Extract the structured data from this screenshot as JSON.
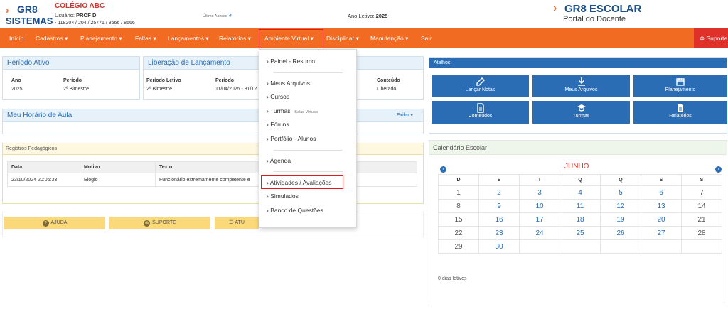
{
  "header": {
    "logo_left_line1": "GR8",
    "logo_left_line2": "SISTEMAS",
    "school": "COLÉGIO ABC",
    "user_label": "Usuário:",
    "user_name": "PROF D",
    "codes": "- 118204 / 204 / 25771 / 8666 / 8666",
    "ultimo_acesso": "Último Acesso",
    "ano_label": "Ano Letivo:",
    "ano_value": "2025",
    "logo_right_line1": "GR8 ESCOLAR",
    "logo_right_line2": "Portal do Docente"
  },
  "nav": {
    "items": [
      "Início",
      "Cadastros ▾",
      "Planejamento ▾",
      "Faltas ▾",
      "Lançamentos ▾",
      "Relatórios ▾",
      "Ambiente Virtual ▾",
      "Disciplinar ▾",
      "Manutenção ▾",
      "Sair"
    ],
    "suporte": "Suporte"
  },
  "periodo": {
    "title": "Período Ativo",
    "ano_label": "Ano",
    "ano_value": "2025",
    "periodo_label": "Período",
    "periodo_value": "2º Bimestre"
  },
  "liberacao": {
    "title": "Liberação de Lançamento",
    "pl_label": "Período Letivo",
    "pl_value": "2º Bimestre",
    "periodo_label": "Período",
    "periodo_value": "11/04/2025 - 31/12",
    "conteudo_label": "Conteúdo",
    "conteudo_value": "Liberado"
  },
  "horario": {
    "title": "Meu Horário de Aula",
    "exibir": "Exibir"
  },
  "registros": {
    "title": "Registros Pedagógicos",
    "columns": [
      "Data",
      "Motivo",
      "Texto"
    ],
    "rows": [
      [
        "23/10/2024 20:06:33",
        "Elogio",
        "Funcionário extremamente competente e"
      ]
    ]
  },
  "bottom_buttons": {
    "ajuda": "AJUDA",
    "suporte": "SUPORTE",
    "atu": "ATU"
  },
  "menu": {
    "items": [
      "Painel - Resumo",
      "Meus Arquivos",
      "Cursos",
      "Turmas",
      "Fóruns",
      "Portfólio - Alunos",
      "Agenda",
      "Atividades / Avaliações",
      "Simulados",
      "Banco de Questões"
    ],
    "turmas_sub": "- Salas Virtuais"
  },
  "atalhos": {
    "title": "Atalhos",
    "buttons": [
      "Lançar Notas",
      "Meus Arquivos",
      "Planejamento",
      "Conteúdos",
      "Turmas",
      "Relatórios"
    ]
  },
  "calendario": {
    "title": "Calendário Escolar",
    "month": "JUNHO",
    "weekdays": [
      "D",
      "S",
      "T",
      "Q",
      "Q",
      "S",
      "S"
    ],
    "weeks": [
      [
        "1",
        "2",
        "3",
        "4",
        "5",
        "6",
        "7"
      ],
      [
        "8",
        "9",
        "10",
        "11",
        "12",
        "13",
        "14"
      ],
      [
        "15",
        "16",
        "17",
        "18",
        "19",
        "20",
        "21"
      ],
      [
        "22",
        "23",
        "24",
        "25",
        "26",
        "27",
        "28"
      ],
      [
        "29",
        "30",
        "",
        "",
        "",
        "",
        ""
      ]
    ],
    "dias_letivos": "0 dias letivos"
  }
}
